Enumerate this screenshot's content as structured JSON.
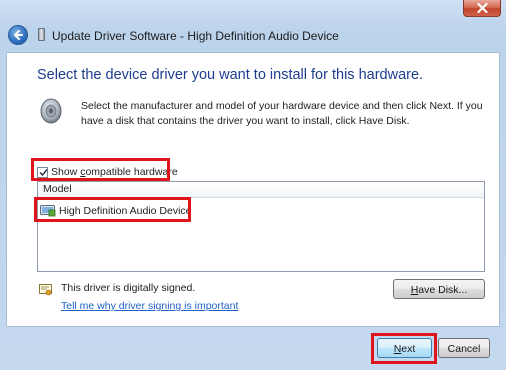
{
  "window": {
    "title": "Update Driver Software - High Definition Audio Device"
  },
  "main": {
    "heading": "Select the device driver you want to install for this hardware.",
    "description": "Select the manufacturer and model of your hardware device and then click Next. If you have a disk that contains the driver you want to install, click Have Disk.",
    "show_compatible": {
      "label_pre": "Show ",
      "label_u": "c",
      "label_post": "ompatible hardware",
      "checked": true
    },
    "list": {
      "column_header": "Model",
      "items": [
        {
          "label": "High Definition Audio Device"
        }
      ]
    },
    "signature": {
      "status_text": "This driver is digitally signed.",
      "link_text": "Tell me why driver signing is important"
    },
    "have_disk_button": {
      "label_u": "H",
      "label_post": "ave Disk..."
    }
  },
  "footer": {
    "next_button": {
      "label_u": "N",
      "label_post": "ext"
    },
    "cancel_button": {
      "label": "Cancel"
    }
  },
  "colors": {
    "heading": "#1f3d8f",
    "link": "#1f62c8",
    "highlight_box": "#e0141b"
  }
}
